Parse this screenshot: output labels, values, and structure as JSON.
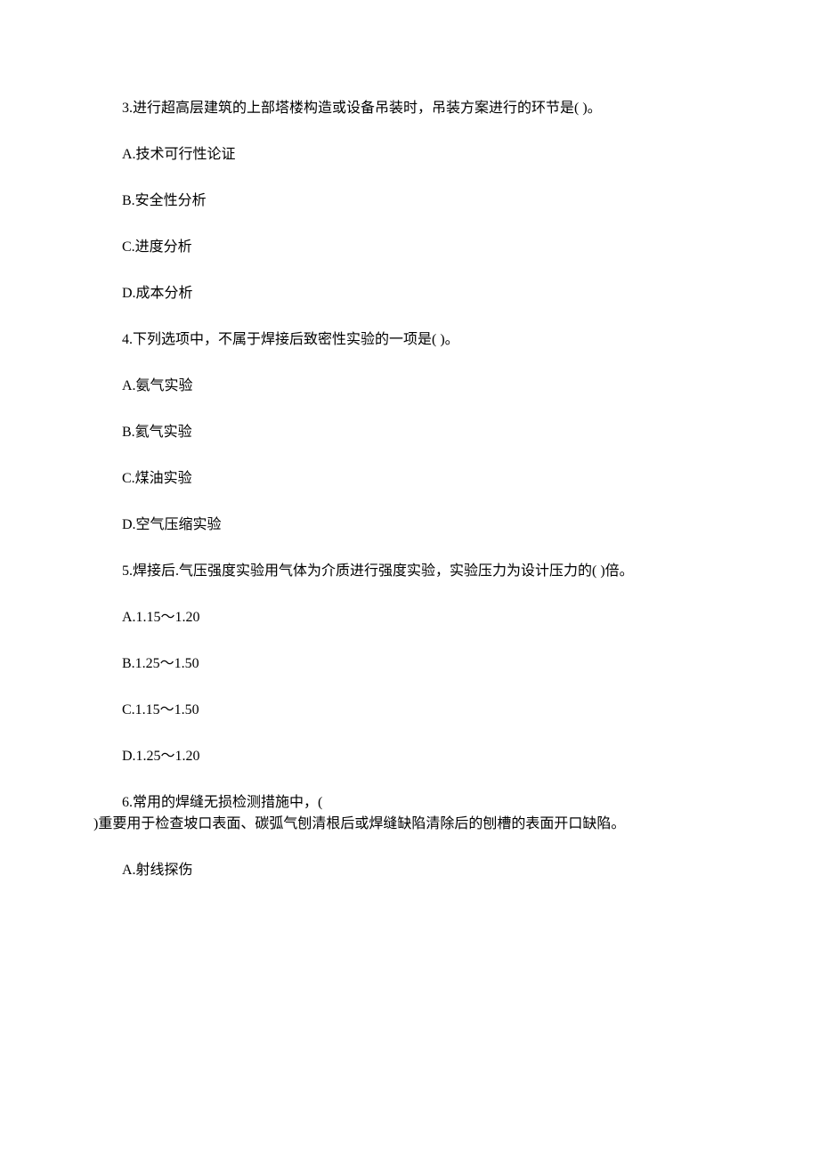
{
  "q3": {
    "stem": "3.进行超高层建筑的上部塔楼构造或设备吊装时，吊装方案进行的环节是( )。",
    "a": "A.技术可行性论证",
    "b": "B.安全性分析",
    "c": "C.进度分析",
    "d": "D.成本分析"
  },
  "q4": {
    "stem": "4.下列选项中，不属于焊接后致密性实验的一项是( )。",
    "a": "A.氨气实验",
    "b": "B.氦气实验",
    "c": "C.煤油实验",
    "d": "D.空气压缩实验"
  },
  "q5": {
    "stem": "5.焊接后.气压强度实验用气体为介质进行强度实验，实验压力为设计压力的( )倍。",
    "a": "A.1.15～1.20",
    "b": "B.1.25～1.50",
    "c": "C.1.15～1.50",
    "d": "D.1.25～1.20"
  },
  "q6": {
    "stem_line1": "6.常用的焊缝无损检测措施中，(",
    "stem_line2": ")重要用于检查坡口表面、碳弧气刨清根后或焊缝缺陷清除后的刨槽的表面开口缺陷。",
    "a": "A.射线探伤"
  }
}
